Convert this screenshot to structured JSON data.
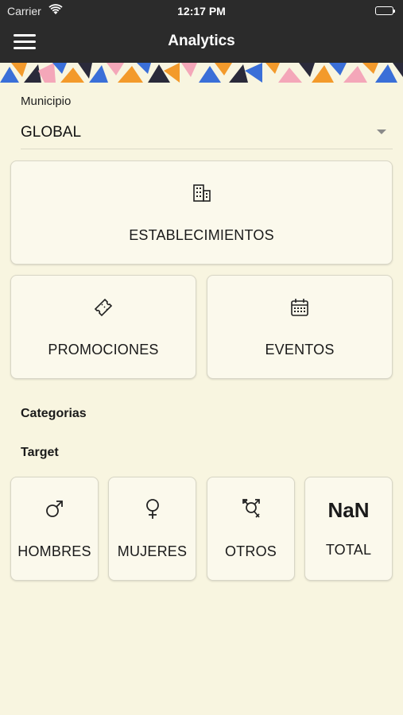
{
  "status_bar": {
    "carrier": "Carrier",
    "time": "12:17 PM"
  },
  "nav": {
    "title": "Analytics",
    "menu_icon": "hamburger-menu-icon"
  },
  "municipio": {
    "label": "Municipio",
    "value": "GLOBAL"
  },
  "cards": {
    "establecimientos": {
      "label": "ESTABLECIMIENTOS",
      "icon": "building-icon"
    },
    "promociones": {
      "label": "PROMOCIONES",
      "icon": "ticket-icon"
    },
    "eventos": {
      "label": "EVENTOS",
      "icon": "calendar-icon"
    }
  },
  "sections": {
    "categorias": "Categorias",
    "target": "Target"
  },
  "target": {
    "hombres": {
      "label": "HOMBRES",
      "icon": "male-symbol-icon"
    },
    "mujeres": {
      "label": "MUJERES",
      "icon": "female-symbol-icon"
    },
    "otros": {
      "label": "OTROS",
      "icon": "transgender-symbol-icon"
    },
    "total": {
      "label": "TOTAL",
      "value": "NaN"
    }
  },
  "colors": {
    "header": "#2b2b2b",
    "background": "#f8f5e0",
    "card": "#fbf9ec",
    "banner_blue": "#3a6fd8",
    "banner_orange": "#f39a2b",
    "banner_dark": "#2a2a3a",
    "banner_pink": "#f4a7b9"
  }
}
